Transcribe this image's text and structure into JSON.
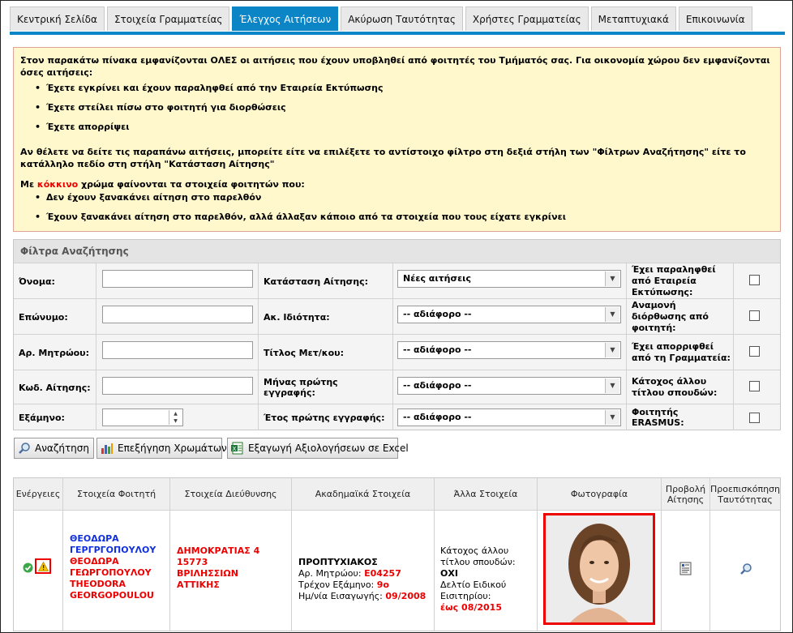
{
  "tabs": [
    "Κεντρική Σελίδα",
    "Στοιχεία Γραμματείας",
    "Έλεγχος Αιτήσεων",
    "Ακύρωση Ταυτότητας",
    "Χρήστες Γραμματείας",
    "Μεταπτυχιακά",
    "Επικοινωνία"
  ],
  "active_tab": 2,
  "notice": {
    "intro": "Στον παρακάτω πίνακα εμφανίζονται ΟΛΕΣ οι αιτήσεις που έχουν υποβληθεί από φοιτητές του Τμήματός σας. Για οικονομία χώρου δεν εμφανίζονται όσες αιτήσεις:",
    "bullets": [
      "Έχετε εγκρίνει και έχουν παραληφθεί από την Εταιρεία Εκτύπωσης",
      "Έχετε στείλει πίσω στο φοιτητή για διορθώσεις",
      "Έχετε απορρίψει"
    ],
    "filter_text": "Αν θέλετε να δείτε τις παραπάνω αιτήσεις, μπορείτε είτε να επιλέξετε το αντίστοιχο φίλτρο στη δεξιά στήλη των \"Φίλτρων Αναζήτησης\" είτε το κατάλληλο πεδίο στη στήλη \"Κατάσταση Αίτησης\"",
    "red_prefix": "Με ",
    "red_word": "κόκκινο",
    "red_suffix": " χρώμα φαίνονται τα στοιχεία φοιτητών που:",
    "red_bullets": [
      "Δεν έχουν ξανακάνει αίτηση στο παρελθόν",
      "Έχουν ξανακάνει αίτηση στο παρελθόν, αλλά άλλαξαν κάποιο από τα στοιχεία που τους είχατε εγκρίνει"
    ]
  },
  "filters": {
    "title": "Φίλτρα Αναζήτησης",
    "col1": [
      "Όνομα:",
      "Επώνυμο:",
      "Αρ. Μητρώου:",
      "Κωδ. Αίτησης:",
      "Εξάμηνο:"
    ],
    "col2": [
      "Κατάσταση Αίτησης:",
      "Ακ. Ιδιότητα:",
      "Τίτλος Μετ/κου:",
      "Μήνας πρώτης εγγραφής:",
      "Έτος πρώτης εγγραφής:"
    ],
    "col2_values": [
      "Νέες αιτήσεις",
      "-- αδιάφορο --",
      "-- αδιάφορο --",
      "-- αδιάφορο --",
      "-- αδιάφορο --"
    ],
    "col3": [
      "Έχει παραληφθεί από Εταιρεία Εκτύπωσης:",
      "Αναμονή διόρθωσης από φοιτητή:",
      "Έχει απορριφθεί από τη Γραμματεία:",
      "Κάτοχος άλλου τίτλου σπουδών:",
      "Φοιτητής ERASMUS:"
    ]
  },
  "buttons": {
    "search": "Αναζήτηση",
    "colors": "Επεξήγηση Χρωμάτων",
    "export": "Εξαγωγή Αξιολογήσεων σε Excel"
  },
  "table": {
    "headers": [
      "Ενέργειες",
      "Στοιχεία Φοιτητή",
      "Στοιχεία Διεύθυνσης",
      "Ακαδημαϊκά Στοιχεία",
      "Άλλα Στοιχεία",
      "Φωτογραφία",
      "Προβολή Αίτησης",
      "Προεπισκόπηση Ταυτότητας"
    ],
    "row": {
      "name_lines": [
        "ΘΕΟΔΩΡΑ",
        "ΓΕΡΓΡΓΟΠΟΥΛΟΥ"
      ],
      "name_red_lines": [
        "ΘΕΟΔΩΡΑ",
        "ΓΕΩΡΓΟΠΟΥΛΟΥ",
        "THEODORA",
        "GEORGOPOULOU"
      ],
      "address_lines": [
        "ΔΗΜΟΚΡΑΤΙΑΣ 4",
        "15773",
        "ΒΡΙΛΗΣΣΙΩΝ",
        "ΑΤΤΙΚΗΣ"
      ],
      "academic": {
        "level": "ΠΡΟΠΤΥΧΙΑΚΟΣ",
        "reg_label": "Αρ. Μητρώου: ",
        "reg_value": "Ε04257",
        "sem_label": "Τρέχον Εξάμηνο: ",
        "sem_value": "9ο",
        "date_label": "Ημ/νία Εισαγωγής: ",
        "date_value": "09/2008"
      },
      "other": {
        "title_label": "Κάτοχος άλλου τίτλου σπουδών: ",
        "title_value": "ΟΧΙ",
        "ticket_label": "Δελτίο Ειδικού Εισιτηρίου:",
        "ticket_value": "έως 08/2015"
      }
    }
  },
  "colors": {
    "tab_active": "#0b85c6",
    "notice_bg": "#fff8cc",
    "highlight": "#e00000",
    "blue_text": "#1030e0"
  }
}
